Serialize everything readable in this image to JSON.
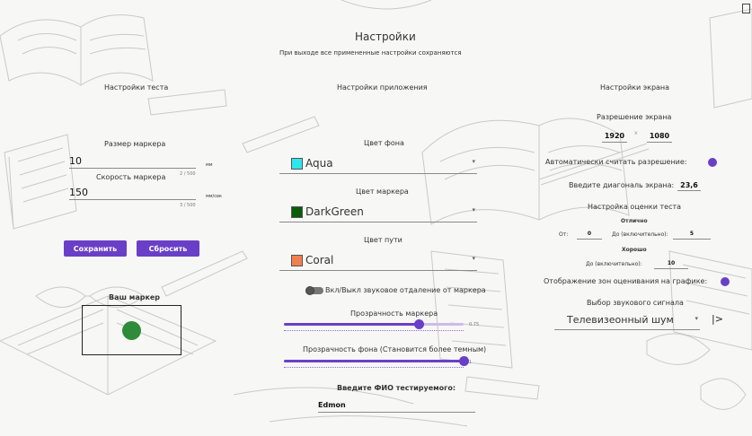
{
  "header": {
    "title": "Настройки",
    "subtitle": "При выходе все примененные настройки сохраняются"
  },
  "sections": {
    "test": "Настройки теста",
    "app": "Настройки приложения",
    "screen": "Настройки экрана"
  },
  "test_settings": {
    "marker_size_label": "Размер маркера",
    "marker_size_value": "10",
    "marker_size_unit": "мм",
    "marker_size_counter": "2 / 500",
    "marker_speed_label": "Скорость маркера",
    "marker_speed_value": "150",
    "marker_speed_unit": "мм/сек",
    "marker_speed_counter": "3 / 500",
    "save_label": "Сохранить",
    "reset_label": "Сбросить",
    "preview_label": "Ваш маркер",
    "marker_color": "#2e8b3a"
  },
  "app_settings": {
    "bg_color_label": "Цвет фона",
    "bg_color_value": "Aqua",
    "bg_color_hex": "#2ee6ee",
    "marker_color_label": "Цвет маркера",
    "marker_color_value": "DarkGreen",
    "marker_color_hex": "#0a5c0a",
    "path_color_label": "Цвет пути",
    "path_color_value": "Coral",
    "path_color_hex": "#f08050",
    "sound_toggle_label": "Вкл/Выкл звуковое отдаление от маркера",
    "sound_toggle_on": false,
    "marker_opacity_label": "Прозрачность маркера",
    "marker_opacity_value": "0.75",
    "marker_opacity_fraction": 0.75,
    "bg_opacity_label": "Прозрачность фона (Становится более темным)",
    "bg_opacity_value": "1",
    "bg_opacity_fraction": 1,
    "fio_label": "Введите ФИО тестируемого:",
    "fio_value": "Edmon"
  },
  "screen_settings": {
    "resolution_label": "Разрешение экрана",
    "width": "1920",
    "times": "x",
    "height": "1080",
    "auto_resolution_label": "Автоматически считать разрешение:",
    "auto_resolution_on": true,
    "diagonal_label": "Введите диагональ экрана:",
    "diagonal_value": "23,6",
    "grading_label": "Настройка оценки теста",
    "excellent_label": "Отлично",
    "from_label": "От:",
    "from_value": "0",
    "to_label": "До (включительно):",
    "to_excellent_value": "5",
    "good_label": "Хорошо",
    "to_good_label": "До (включительно):",
    "to_good_value": "10",
    "zones_label": "Отображение зон оценивания на графике:",
    "zones_on": true,
    "sound_signal_label": "Выбор звукового сигнала",
    "sound_signal_value": "Телевизеонный шум",
    "play_label": "|>"
  },
  "accent_color": "#6a3fc7"
}
